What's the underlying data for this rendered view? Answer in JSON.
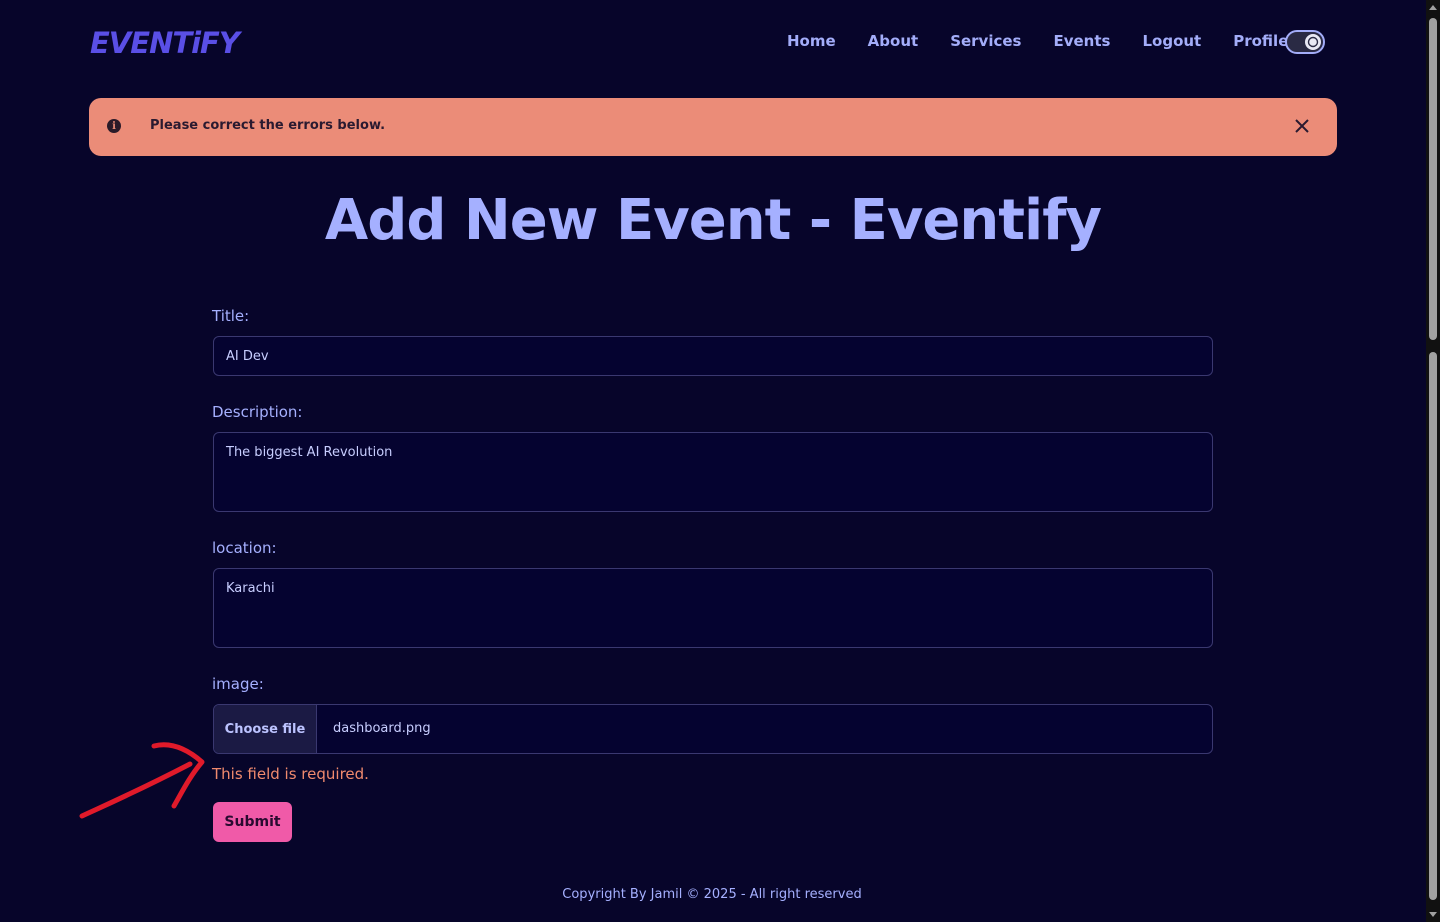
{
  "brand": {
    "logo_text": "EVENTiFY"
  },
  "nav": {
    "items": [
      "Home",
      "About",
      "Services",
      "Events",
      "Logout",
      "Profile"
    ]
  },
  "theme_toggle": {
    "icon": "moon-icon",
    "state": "dark"
  },
  "alert": {
    "icon": "info-circle-icon",
    "message": "Please correct the errors below.",
    "close_icon": "close-icon",
    "color": "#eb8c78"
  },
  "page": {
    "title": "Add New Event - Eventify"
  },
  "form": {
    "title_label": "Title:",
    "title_value": "AI Dev",
    "description_label": "Description:",
    "description_value": "The biggest AI Revolution",
    "location_label": "location:",
    "location_value": "Karachi",
    "image_label": "image:",
    "choose_file_label": "Choose file",
    "file_name": "dashboard.png",
    "error_message": "This field is required.",
    "submit_label": "Submit",
    "submit_color": "#f05aa8",
    "error_color": "#f08a6e"
  },
  "annotation": {
    "icon": "red-arrow-annotation"
  },
  "footer": {
    "text": "Copyright By Jamil © 2025 - All right reserved"
  }
}
